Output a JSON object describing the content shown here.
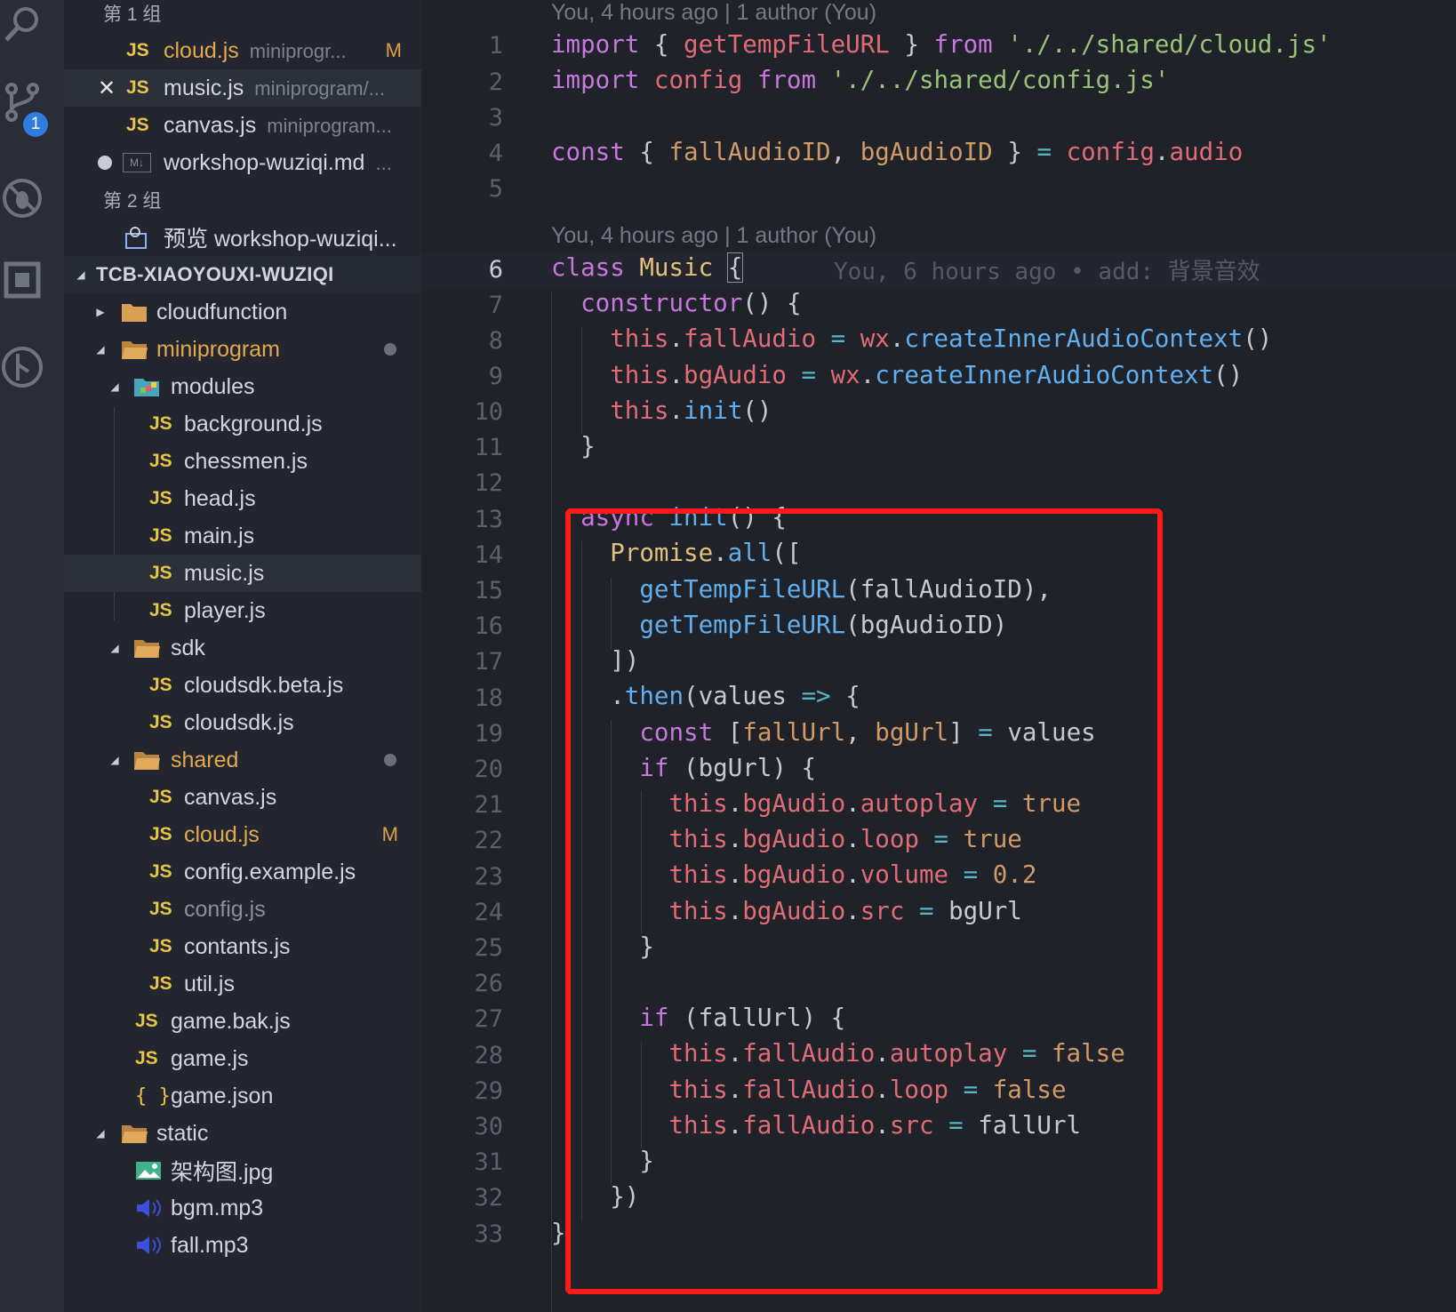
{
  "activity_bar": {
    "icons": [
      "search-icon",
      "source-control-icon",
      "debug-icon",
      "extensions-icon",
      "git-history-icon"
    ],
    "scm_badge": "1"
  },
  "open_editors": {
    "group1_title": "第 1 组",
    "group2_title": "第 2 组",
    "items": [
      {
        "icon": "JS",
        "name": "cloud.js",
        "desc": "miniprogr...",
        "status": "M"
      },
      {
        "icon": "JS",
        "name": "music.js",
        "desc": "miniprogram/..."
      },
      {
        "icon": "JS",
        "name": "canvas.js",
        "desc": "miniprogram..."
      },
      {
        "icon": "M↓",
        "name": "workshop-wuziqi.md",
        "desc": "..."
      },
      {
        "icon": "preview",
        "name": "预览 workshop-wuziqi..."
      }
    ]
  },
  "explorer": {
    "root": "TCB-XIAOYOUXI-WUZIQI",
    "tree": [
      {
        "name": "cloudfunction",
        "type": "folder"
      },
      {
        "name": "miniprogram",
        "type": "folder"
      },
      {
        "name": "modules",
        "type": "folder"
      },
      {
        "name": "background.js",
        "icon": "JS"
      },
      {
        "name": "chessmen.js",
        "icon": "JS"
      },
      {
        "name": "head.js",
        "icon": "JS"
      },
      {
        "name": "main.js",
        "icon": "JS"
      },
      {
        "name": "music.js",
        "icon": "JS"
      },
      {
        "name": "player.js",
        "icon": "JS"
      },
      {
        "name": "sdk",
        "type": "folder"
      },
      {
        "name": "cloudsdk.beta.js",
        "icon": "JS"
      },
      {
        "name": "cloudsdk.js",
        "icon": "JS"
      },
      {
        "name": "shared",
        "type": "folder"
      },
      {
        "name": "canvas.js",
        "icon": "JS"
      },
      {
        "name": "cloud.js",
        "icon": "JS",
        "status": "M"
      },
      {
        "name": "config.example.js",
        "icon": "JS"
      },
      {
        "name": "config.js",
        "icon": "JS"
      },
      {
        "name": "contants.js",
        "icon": "JS"
      },
      {
        "name": "util.js",
        "icon": "JS"
      },
      {
        "name": "game.bak.js",
        "icon": "JS"
      },
      {
        "name": "game.js",
        "icon": "JS"
      },
      {
        "name": "game.json",
        "icon": "{ }"
      },
      {
        "name": "static",
        "type": "folder"
      },
      {
        "name": "架构图.jpg",
        "type": "image"
      },
      {
        "name": "bgm.mp3",
        "type": "audio"
      },
      {
        "name": "fall.mp3",
        "type": "audio"
      }
    ]
  },
  "editor": {
    "blame_top": "You, 4 hours ago | 1 author (You)",
    "blame_class": "You, 4 hours ago | 1 author (You)",
    "inline_blame": "You, 6 hours ago • add: 背景音效",
    "line_numbers": [
      "1",
      "2",
      "3",
      "4",
      "5",
      "6",
      "7",
      "8",
      "9",
      "10",
      "11",
      "12",
      "13",
      "14",
      "15",
      "16",
      "17",
      "18",
      "19",
      "20",
      "21",
      "22",
      "23",
      "24",
      "25",
      "26",
      "27",
      "28",
      "29",
      "30",
      "31",
      "32",
      "33"
    ],
    "lines": [
      "import { getTempFileURL } from './../shared/cloud.js'",
      "import config from './../shared/config.js'",
      "",
      "const { fallAudioID, bgAudioID } = config.audio",
      "",
      "class Music {",
      "  constructor() {",
      "    this.fallAudio = wx.createInnerAudioContext()",
      "    this.bgAudio = wx.createInnerAudioContext()",
      "    this.init()",
      "  }",
      "",
      "  async init() {",
      "    Promise.all([",
      "      getTempFileURL(fallAudioID),",
      "      getTempFileURL(bgAudioID)",
      "    ])",
      "    .then(values => {",
      "      const [fallUrl, bgUrl] = values",
      "      if (bgUrl) {",
      "        this.bgAudio.autoplay = true",
      "        this.bgAudio.loop = true",
      "        this.bgAudio.volume = 0.2",
      "        this.bgAudio.src = bgUrl",
      "      }",
      "",
      "      if (fallUrl) {",
      "        this.fallAudio.autoplay = false",
      "        this.fallAudio.loop = false",
      "        this.fallAudio.src = fallUrl",
      "      }",
      "    })",
      "}"
    ]
  }
}
